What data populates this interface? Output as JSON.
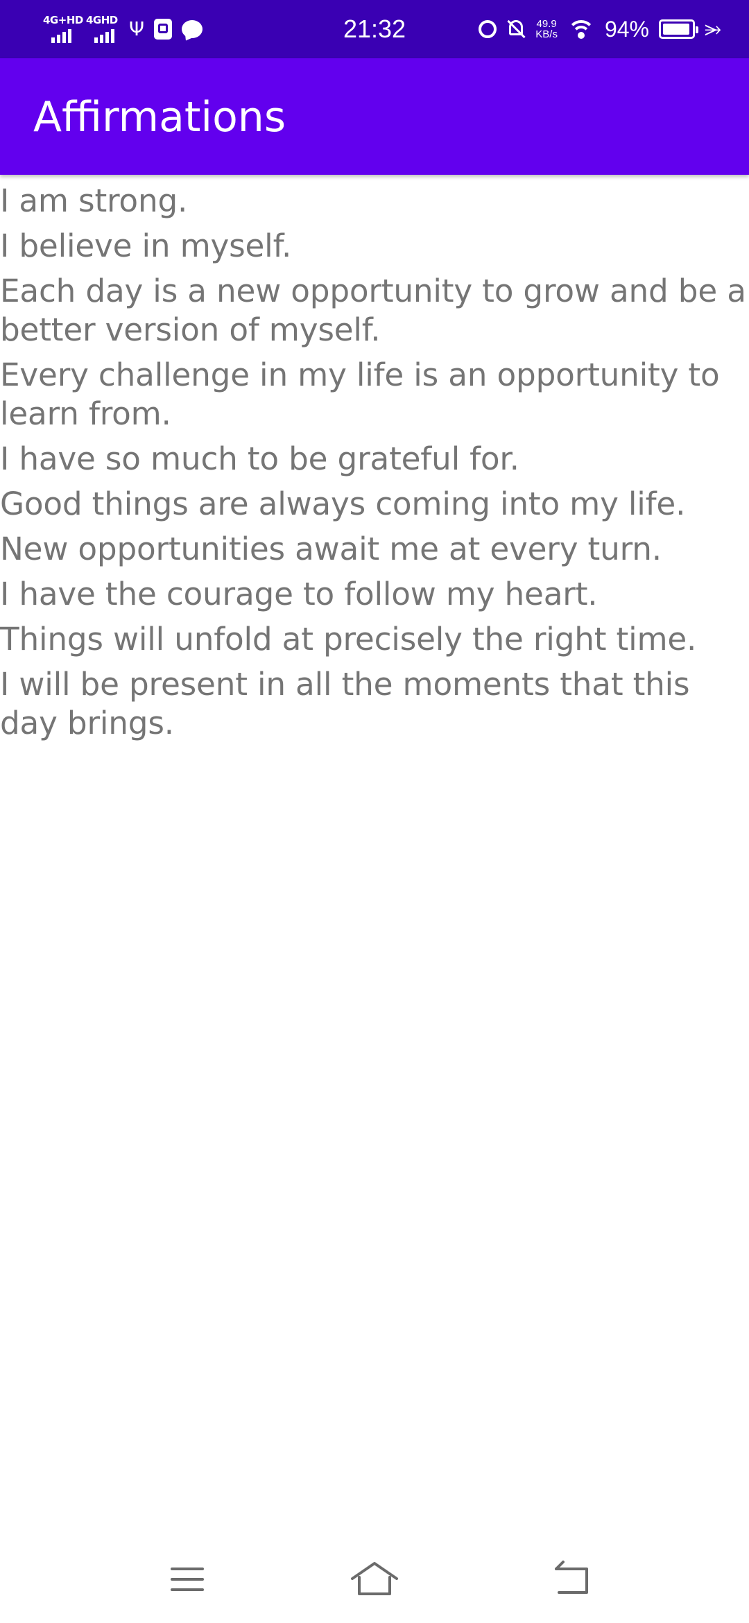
{
  "status_bar": {
    "signal_1_label": "4G+HD",
    "signal_2_label": "4GHD",
    "time": "21:32",
    "speed_value": "49.9",
    "speed_unit": "KB/s",
    "battery_text": "94%",
    "battery_level_percent": 94,
    "icons": [
      "usb-icon",
      "sd-card-icon",
      "message-icon",
      "alarm-icon",
      "bell-muted-icon",
      "wifi-icon",
      "battery-icon",
      "charging-icon"
    ]
  },
  "app_bar": {
    "title": "Affirmations"
  },
  "affirmations": [
    "I am strong.",
    "I believe in myself.",
    "Each day is a new opportunity to grow and be a better version of myself.",
    "Every challenge in my life is an opportunity to learn from.",
    "I have so much to be grateful for.",
    "Good things are always coming into my life.",
    "New opportunities await me at every turn.",
    "I have the courage to follow my heart.",
    "Things will unfold at precisely the right time.",
    "I will be present in all the moments that this day brings."
  ],
  "nav_bar": {
    "icons": [
      "menu-icon",
      "home-icon",
      "back-icon"
    ]
  },
  "colors": {
    "status_bar": "#3A00B3",
    "app_bar": "#6200EE",
    "text": "#757575",
    "background": "#FFFFFF"
  }
}
